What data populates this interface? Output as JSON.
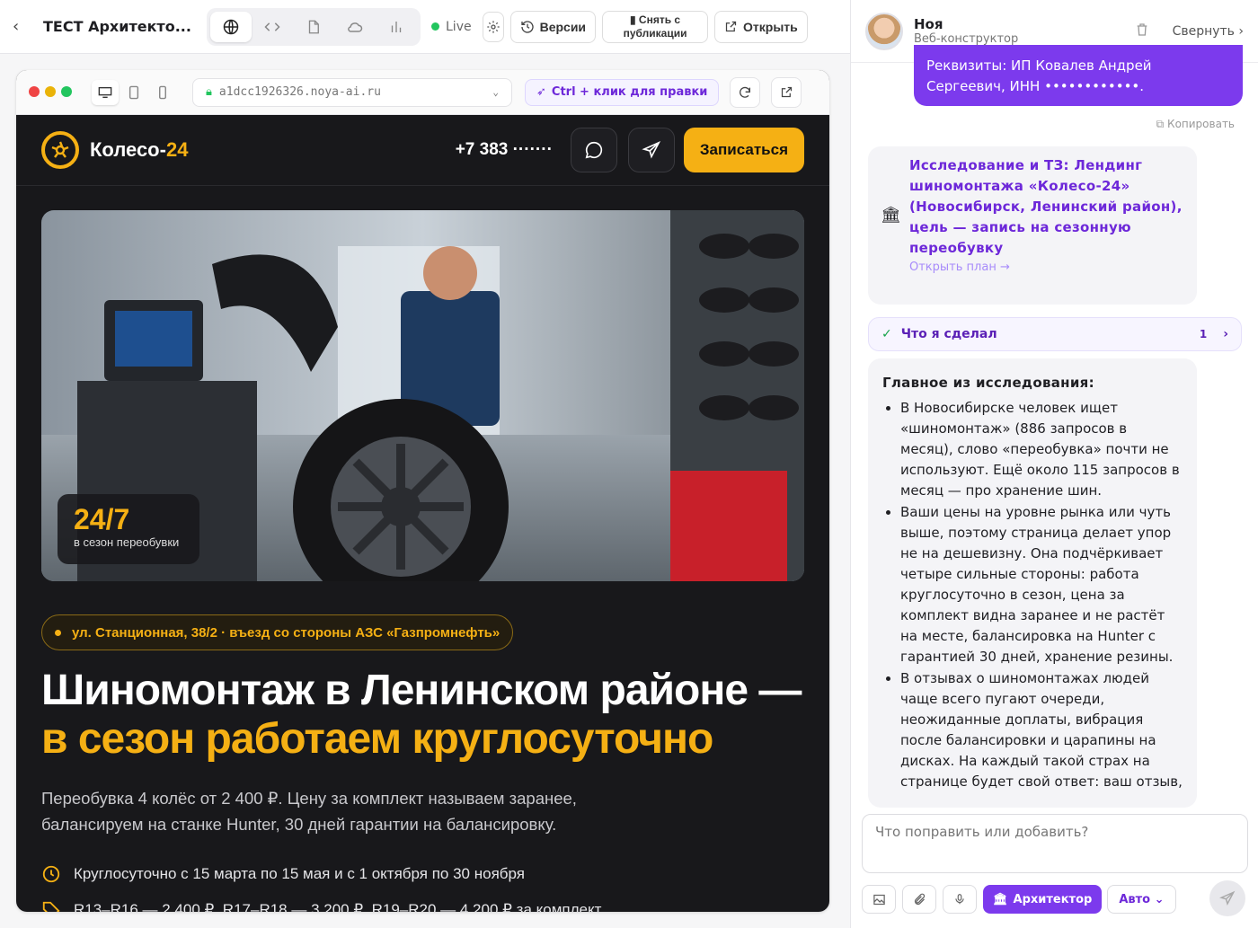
{
  "topbar": {
    "title": "ТЕСТ Архитекто...",
    "live_label": "Live",
    "versions_label": "Версии",
    "unpublish_label": "▮ Снять с публикации",
    "open_label": "Открыть"
  },
  "browser": {
    "url": "a1dcc1926326.noya-ai.ru",
    "ctrl_hint": "Ctrl + клик для правки"
  },
  "site": {
    "logo_main": "Колесо-",
    "logo_accent": "24",
    "phone": "+7 383 ·······",
    "signup_label": "Записаться",
    "badge_number": "24/7",
    "badge_caption": "в сезон переобувки",
    "address": "ул. Станционная, 38/2 · въезд со стороны АЗС «Газпромнефть»",
    "headline_main": "Шиномонтаж в Ленинском районе — ",
    "headline_accent": "в сезон работаем круглосуточно",
    "lead": "Переобувка 4 колёс от 2 400 ₽. Цену за комплект называем заранее, балансируем на станке Hunter, 30 дней гарантии на балансировку.",
    "feature_1": "Круглосуточно с 15 марта по 15 мая и с 1 октября по 30 ноября",
    "feature_2": "R13–R16 — 2 400 ₽, R17–R18 — 3 200 ₽, R19–R20 — 4 200 ₽ за комплект"
  },
  "chat": {
    "name": "Ноя",
    "role": "Веб-конструктор",
    "collapse_label": "Свернуть",
    "user_message": "Реквизиты: ИП Ковалев Андрей Сергеевич, ИНН ••••••••••••.",
    "copy_label": "Копировать",
    "plan_title": "Исследование и ТЗ: Лендинг шиномонтажа «Колесо-24» (Новосибирск, Ленинский район), цель — запись на сезонную переобувку",
    "plan_link": "Открыть план →",
    "did_label": "Что я сделал",
    "did_count": "1",
    "research_heading": "Главное из исследования:",
    "research_items": [
      "В Новосибирске человек ищет «шиномонтаж» (886 запросов в месяц), слово «переобувка» почти не используют. Ещё около 115 запросов в месяц — про хранение шин.",
      "Ваши цены на уровне рынка или чуть выше, поэтому страница делает упор не на дешевизну. Она подчёркивает четыре сильные стороны: работа круглосуточно в сезон, цена за комплект видна заранее и не растёт на месте, балансировка на Hunter с гарантией 30 дней, хранение резины.",
      "В отзывах о шиномонтажах людей чаще всего пугают очереди, неожиданные доплаты, вибрация после балансировки и царапины на дисках. На каждый такой страх на странице будет свой ответ: ваш отзыв,"
    ],
    "input_placeholder": "Что поправить или добавить?",
    "architect_label": "Архитектор",
    "auto_label": "Авто ⌄"
  },
  "colors": {
    "accent_yellow": "#f5b014",
    "accent_purple": "#7c3aed",
    "dark_bg": "#18181b"
  }
}
